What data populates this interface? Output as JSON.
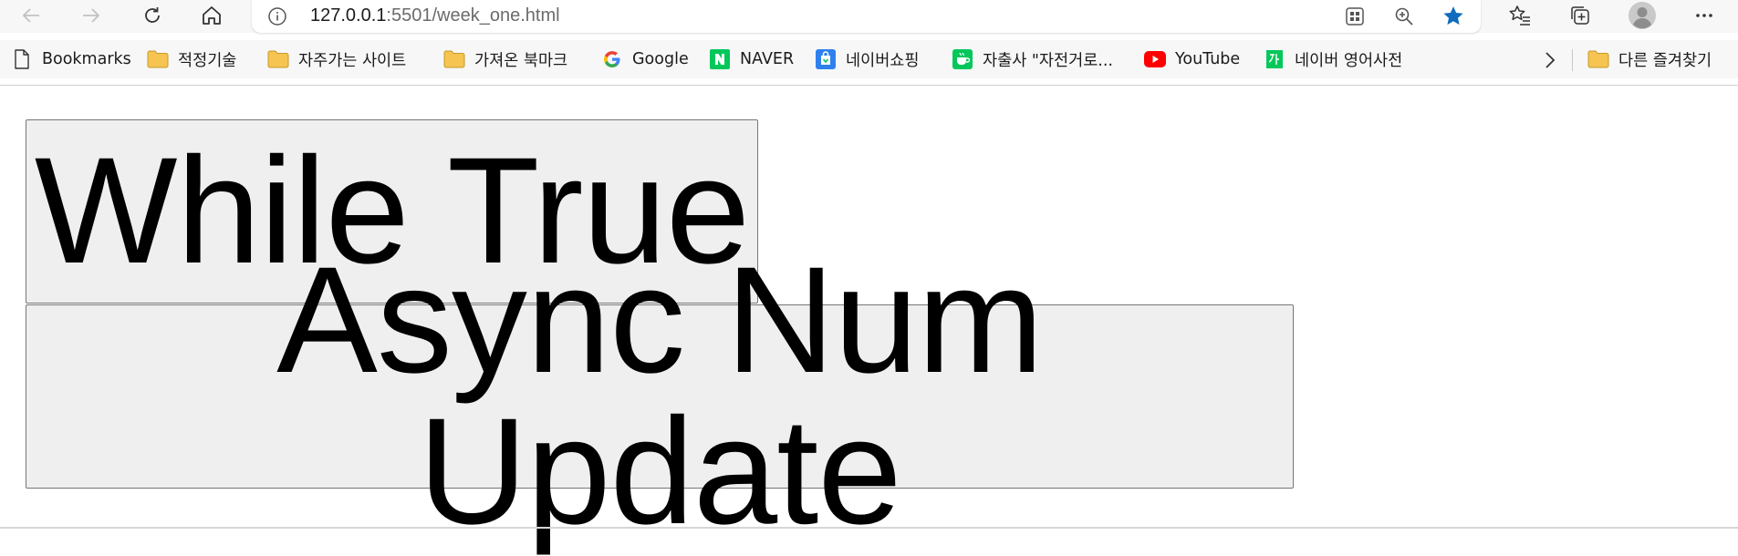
{
  "browser": {
    "address_bar": {
      "url_host": "127.0.0.1",
      "url_rest": ":5501/week_one.html"
    },
    "bookmarks": [
      {
        "label": "Bookmarks",
        "icon": "page-icon"
      },
      {
        "label": "적정기술",
        "icon": "folder-icon"
      },
      {
        "label": "자주가는 사이트",
        "icon": "folder-icon"
      },
      {
        "label": "가져온 북마크",
        "icon": "folder-icon"
      },
      {
        "label": "Google",
        "icon": "google-icon"
      },
      {
        "label": "NAVER",
        "icon": "naver-icon"
      },
      {
        "label": "네이버쇼핑",
        "icon": "naver-shopping-icon"
      },
      {
        "label": "자출사 \"자전거로...",
        "icon": "cafe-icon"
      },
      {
        "label": "YouTube",
        "icon": "youtube-icon"
      },
      {
        "label": "네이버 영어사전",
        "icon": "naver-dict-icon"
      }
    ],
    "other_bookmarks_label": "다른 즐겨찾기",
    "colors": {
      "star": "#0f6cbd",
      "folder": "#f5c451",
      "naver": "#03c75a",
      "youtube": "#ff0000"
    }
  },
  "page": {
    "buttons": [
      {
        "label": "While True"
      },
      {
        "label": "Async Num Update"
      }
    ]
  }
}
